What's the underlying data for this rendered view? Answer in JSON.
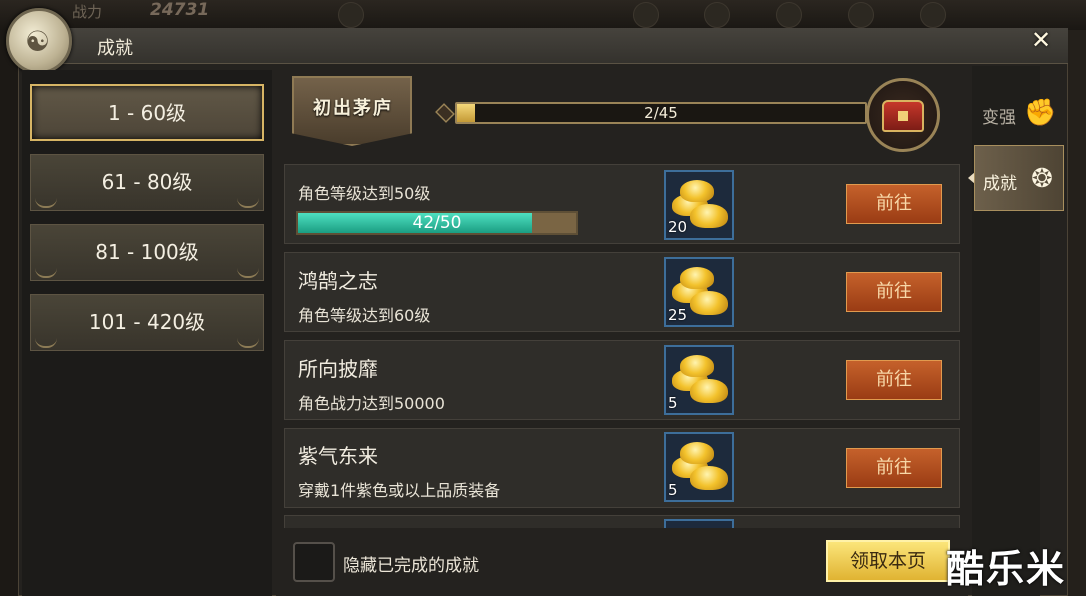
{
  "background": {
    "power_label": "战力",
    "power_value": "24731"
  },
  "window": {
    "title": "成就",
    "close_icon": "close-icon"
  },
  "level_tabs": [
    {
      "label": "1 - 60级",
      "active": true
    },
    {
      "label": "61 - 80级",
      "active": false
    },
    {
      "label": "81 - 100级",
      "active": false
    },
    {
      "label": "101 - 420级",
      "active": false
    }
  ],
  "header": {
    "banner_title": "初出茅庐",
    "progress_text": "2/45",
    "progress_current": 2,
    "progress_total": 45,
    "chest_icon": "treasure-chest-icon"
  },
  "achievements": [
    {
      "name": "",
      "desc": "角色等级达到50级",
      "progress_text": "42/50",
      "progress_current": 42,
      "progress_total": 50,
      "reward_count": "20",
      "button": "前往"
    },
    {
      "name": "鸿鹄之志",
      "desc": "角色等级达到60级",
      "reward_count": "25",
      "button": "前往"
    },
    {
      "name": "所向披靡",
      "desc": "角色战力达到50000",
      "reward_count": "5",
      "button": "前往"
    },
    {
      "name": "紫气东来",
      "desc": "穿戴1件紫色或以上品质装备",
      "reward_count": "5",
      "button": "前往"
    }
  ],
  "footer": {
    "hide_completed_label": "隐藏已完成的成就",
    "claim_page_label": "领取本页"
  },
  "side_tabs": [
    {
      "label": "变强",
      "icon": "fist-icon",
      "active": false
    },
    {
      "label": "成就",
      "icon": "mask-icon",
      "active": true
    }
  ],
  "watermark": "酷乐米",
  "colors": {
    "accent_gold": "#d7b565",
    "progress_teal": "#1b9d82",
    "button_orange": "#c5612b",
    "reward_border_blue": "#3d6e9a"
  }
}
